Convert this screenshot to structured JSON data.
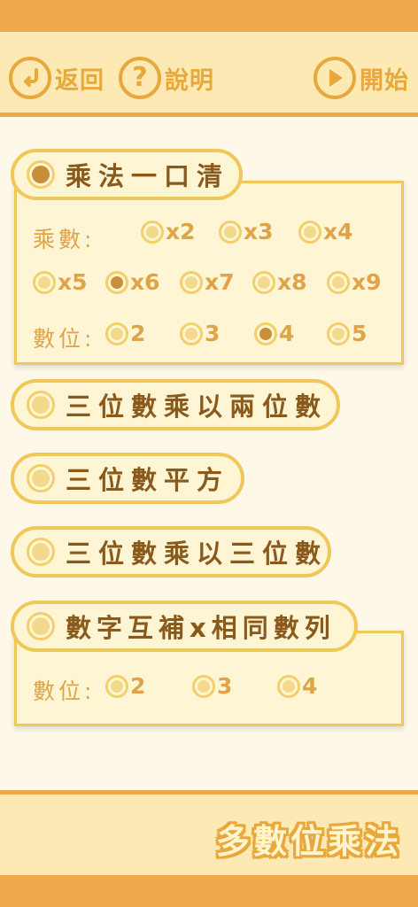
{
  "header": {
    "back_label": "返回",
    "help_label": "說明",
    "start_label": "開始",
    "back_icon": "back-arrow-icon",
    "help_icon": "question-icon",
    "start_icon": "play-icon"
  },
  "modes": {
    "mode1": {
      "label": "乘法一口清",
      "selected": true,
      "multiplier_label": "乘數:",
      "multipliers": [
        "x2",
        "x3",
        "x4",
        "x5",
        "x6",
        "x7",
        "x8",
        "x9"
      ],
      "multiplier_selected": "x6",
      "digits_label": "數位:",
      "digits": [
        "2",
        "3",
        "4",
        "5"
      ],
      "digits_selected": "4"
    },
    "mode2": {
      "label": "三位數乘以兩位數",
      "selected": false
    },
    "mode3": {
      "label": "三位數平方",
      "selected": false
    },
    "mode4": {
      "label": "三位數乘以三位數",
      "selected": false
    },
    "mode5": {
      "label": "數字互補x相同數列",
      "selected": false,
      "digits_label": "數位:",
      "digits": [
        "2",
        "3",
        "4"
      ]
    }
  },
  "footer": {
    "title": "多數位乘法"
  },
  "colors": {
    "accent": "#eeaa4a",
    "panel": "#fde9b4",
    "text_dark": "#8a5a1c",
    "text_light": "#e0a348",
    "selected": "#c98e3a"
  }
}
